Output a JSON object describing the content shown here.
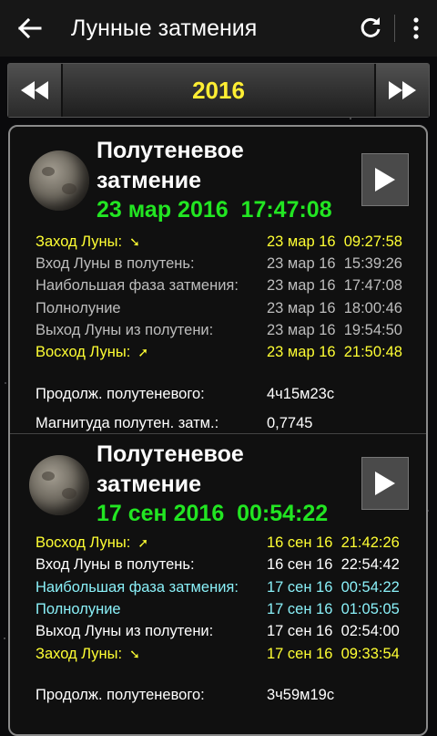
{
  "app": {
    "title": "Лунные затмения"
  },
  "icons": {
    "back": "arrow-left-icon",
    "refresh": "refresh-icon",
    "menu": "overflow-menu-icon",
    "prev": "double-chevron-left-icon",
    "next": "double-chevron-right-icon",
    "play": "play-icon"
  },
  "year": "2016",
  "events": [
    {
      "title": "Полутеневое затмение",
      "datetime": "23 мар 2016  17:47:08",
      "rows": [
        {
          "label": "Заход Луны:",
          "value": "23 мар 16  09:27:58",
          "color": "yellow",
          "arrow": "arrow-down-right"
        },
        {
          "label": "Вход Луны в полутень:",
          "value": "23 мар 16  15:39:26",
          "color": "gray"
        },
        {
          "label": "Наибольшая фаза затмения:",
          "value": "23 мар 16  17:47:08",
          "color": "gray"
        },
        {
          "label": "Полнолуние",
          "value": "23 мар 16  18:00:46",
          "color": "gray"
        },
        {
          "label": "Выход Луны из полутени:",
          "value": "23 мар 16  19:54:50",
          "color": "gray"
        },
        {
          "label": "Восход Луны:",
          "value": "23 мар 16  21:50:48",
          "color": "yellow",
          "arrow": "arrow-up-right"
        }
      ],
      "stats": [
        {
          "label": "Продолж. полутеневого:",
          "value": "4ч15м23с"
        },
        {
          "label": "Магнитуда полутен. затм.:",
          "value": "0,7745"
        }
      ]
    },
    {
      "title": "Полутеневое затмение",
      "datetime": "17 сен 2016  00:54:22",
      "rows": [
        {
          "label": "Восход Луны:",
          "value": "16 сен 16  21:42:26",
          "color": "yellow",
          "arrow": "arrow-up-right"
        },
        {
          "label": "Вход Луны в полутень:",
          "value": "16 сен 16  22:54:42",
          "color": "white"
        },
        {
          "label": "Наибольшая фаза затмения:",
          "value": "17 сен 16  00:54:22",
          "color": "cyan"
        },
        {
          "label": "Полнолуние",
          "value": "17 сен 16  01:05:05",
          "color": "cyan"
        },
        {
          "label": "Выход Луны из полутени:",
          "value": "17 сен 16  02:54:00",
          "color": "white"
        },
        {
          "label": "Заход Луны:",
          "value": "17 сен 16  09:33:54",
          "color": "yellow",
          "arrow": "arrow-down-right"
        }
      ],
      "stats": [
        {
          "label": "Продолж. полутеневого:",
          "value": "3ч59м19с"
        }
      ]
    }
  ],
  "colors": {
    "title_green": "#22e622",
    "yellow": "#ffff33",
    "gray": "#bdbdbd",
    "white": "#ffffff",
    "cyan": "#8af0f8"
  }
}
